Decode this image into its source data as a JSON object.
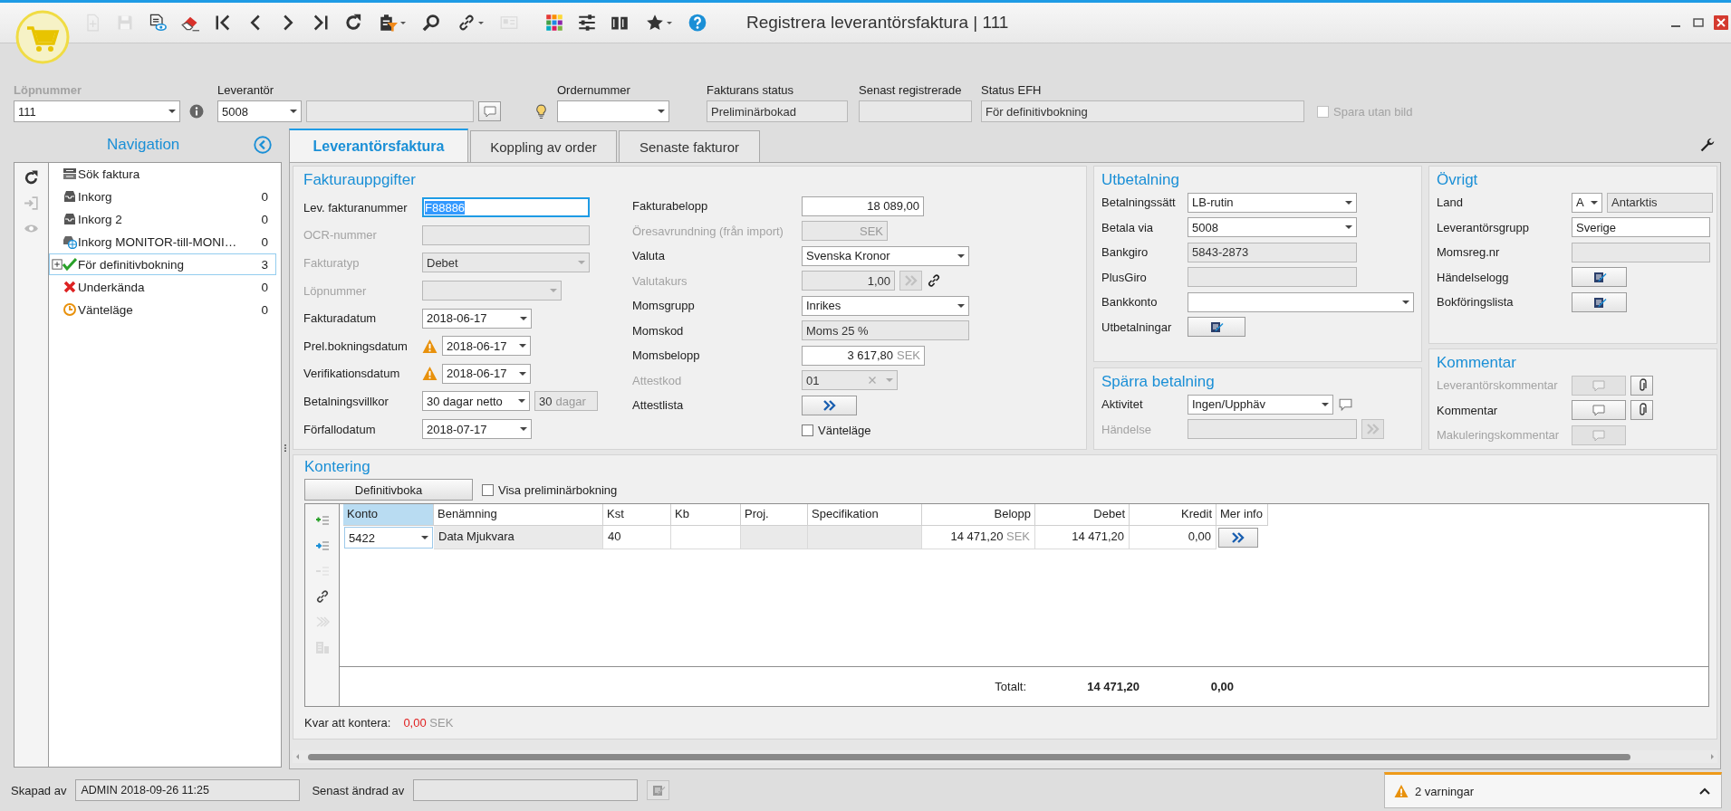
{
  "window": {
    "title": "Registrera leverantörsfaktura | 111"
  },
  "toolbar": [
    {
      "kind": "new",
      "disabled": true
    },
    {
      "kind": "save",
      "disabled": true
    },
    {
      "kind": "preview",
      "disabled": false
    },
    {
      "kind": "erase",
      "disabled": false
    },
    {
      "kind": "first",
      "disabled": false
    },
    {
      "kind": "previous",
      "disabled": false
    },
    {
      "kind": "next",
      "disabled": false
    },
    {
      "kind": "last",
      "disabled": false
    },
    {
      "kind": "refresh",
      "disabled": false
    },
    {
      "kind": "clipboard",
      "disabled": false,
      "dropdown": true
    },
    {
      "kind": "search",
      "disabled": false
    },
    {
      "kind": "link",
      "disabled": false,
      "dropdown": true
    },
    {
      "kind": "card",
      "disabled": true
    },
    {
      "kind": "colors",
      "disabled": false
    },
    {
      "kind": "sliders",
      "disabled": false
    },
    {
      "kind": "book",
      "disabled": false
    },
    {
      "kind": "star",
      "disabled": false,
      "dropdown": true
    },
    {
      "kind": "help",
      "disabled": false
    }
  ],
  "header": [
    {
      "label": "Löpnummer",
      "label_disabled": true,
      "fields": [
        {
          "kind": "combo",
          "value": "111"
        },
        {
          "kind": "info_button",
          "disabled": false
        }
      ]
    },
    {
      "label": "Leverantör",
      "label_disabled": false,
      "fields": [
        {
          "kind": "combo",
          "value": "5008"
        },
        {
          "kind": "text",
          "readonly": true
        },
        {
          "kind": "comment_button",
          "disabled": false
        }
      ]
    },
    {
      "fields": [
        {
          "kind": "bulb_icon"
        }
      ]
    },
    {
      "label": "Ordernummer",
      "label_disabled": false,
      "fields": [
        {
          "kind": "combo"
        }
      ]
    },
    {
      "label": "Fakturans status",
      "label_disabled": false,
      "fields": [
        {
          "kind": "text",
          "readonly": true,
          "value": "Preliminärbokad"
        }
      ]
    },
    {
      "label": "Senast registrerade",
      "label_disabled": false,
      "fields": [
        {
          "kind": "text",
          "readonly": true
        }
      ]
    },
    {
      "label": "Status EFH",
      "label_disabled": false,
      "fields": [
        {
          "kind": "text",
          "readonly": true,
          "value": "För definitivbokning"
        }
      ]
    },
    {
      "fields": [
        {
          "kind": "checkbox",
          "label": "Spara utan bild",
          "checked": false,
          "disabled": true
        }
      ]
    }
  ],
  "navigation": {
    "title": "Navigation",
    "tools": [
      {
        "kind": "refresh",
        "disabled": false
      },
      {
        "kind": "login",
        "disabled": true
      },
      {
        "kind": "eye",
        "disabled": true
      }
    ],
    "items": [
      {
        "kind": "search",
        "label": "Sök faktura",
        "selected": false
      },
      {
        "kind": "inbox",
        "label": "Inkorg",
        "count": "0",
        "selected": false
      },
      {
        "kind": "inbox",
        "label": "Inkorg 2",
        "count": "0",
        "selected": false
      },
      {
        "kind": "inbox_globe",
        "label": "Inkorg MONITOR-till-MONI…",
        "count": "0",
        "selected": false
      },
      {
        "kind": "check",
        "label": "För definitivbokning",
        "count": "3",
        "selected": true,
        "expanded": false
      },
      {
        "kind": "cross",
        "label": "Underkända",
        "count": "0",
        "selected": false
      },
      {
        "kind": "clock",
        "label": "Vänteläge",
        "count": "0",
        "selected": false
      }
    ]
  },
  "tabs": [
    {
      "label": "Leverantörsfaktura",
      "selected": true
    },
    {
      "label": "Koppling av order",
      "selected": false
    },
    {
      "label": "Senaste fakturor",
      "selected": false
    }
  ],
  "fakturauppgifter": {
    "title": "Fakturauppgifter",
    "left": [
      {
        "label": "Lev. fakturanummer",
        "label_disabled": false,
        "fields": [
          {
            "kind": "text",
            "value": "F88886",
            "focused": true
          }
        ]
      },
      {
        "label": "OCR-nummer",
        "label_disabled": true,
        "fields": [
          {
            "kind": "text",
            "readonly": true
          }
        ]
      },
      {
        "label": "Fakturatyp",
        "label_disabled": true,
        "fields": [
          {
            "kind": "combo",
            "readonly": true,
            "value": "Debet"
          }
        ]
      },
      {
        "label": "Löpnummer",
        "label_disabled": true,
        "fields": [
          {
            "kind": "combo",
            "readonly": true
          }
        ]
      },
      {
        "label": "Fakturadatum",
        "label_disabled": false,
        "fields": [
          {
            "kind": "combo",
            "value": "2018-06-17"
          }
        ]
      },
      {
        "label": "Prel.bokningsdatum",
        "label_disabled": false,
        "fields": [
          {
            "kind": "warning_icon"
          },
          {
            "kind": "combo",
            "value": "2018-06-17"
          }
        ]
      },
      {
        "label": "Verifikationsdatum",
        "label_disabled": false,
        "fields": [
          {
            "kind": "warning_icon"
          },
          {
            "kind": "combo",
            "value": "2018-06-17"
          }
        ]
      },
      {
        "label": "Betalningsvillkor",
        "label_disabled": false,
        "fields": [
          {
            "kind": "combo",
            "value": "30 dagar netto"
          },
          {
            "kind": "text",
            "readonly": true,
            "value": "30",
            "suffix": "dagar"
          }
        ]
      },
      {
        "label": "Förfallodatum",
        "label_disabled": false,
        "fields": [
          {
            "kind": "combo",
            "value": "2018-07-17"
          }
        ]
      }
    ],
    "right": [
      {
        "label": "Fakturabelopp",
        "label_disabled": false,
        "fields": [
          {
            "kind": "amount",
            "value": "18 089,00"
          }
        ]
      },
      {
        "label": "Öresavrundning (från import)",
        "label_disabled": true,
        "fields": [
          {
            "kind": "amount",
            "readonly": true,
            "suffix": "SEK"
          }
        ]
      },
      {
        "label": "Valuta",
        "label_disabled": false,
        "fields": [
          {
            "kind": "combo",
            "value": "Svenska Kronor"
          }
        ]
      },
      {
        "label": "Valutakurs",
        "label_disabled": true,
        "fields": [
          {
            "kind": "amount",
            "readonly": true,
            "value": "1,00"
          },
          {
            "kind": "chevron_button",
            "disabled": true
          },
          {
            "kind": "link_icon"
          }
        ]
      },
      {
        "label": "Momsgrupp",
        "label_disabled": false,
        "fields": [
          {
            "kind": "combo",
            "value": "Inrikes"
          }
        ]
      },
      {
        "label": "Momskod",
        "label_disabled": false,
        "fields": [
          {
            "kind": "text",
            "readonly": true,
            "value": "Moms 25 %"
          }
        ]
      },
      {
        "label": "Momsbelopp",
        "label_disabled": false,
        "fields": [
          {
            "kind": "amount",
            "value": "3 617,80",
            "suffix": "SEK"
          }
        ]
      },
      {
        "label": "Attestkod",
        "label_disabled": true,
        "fields": [
          {
            "kind": "combo",
            "readonly": true,
            "value": "01",
            "clearable": true
          }
        ]
      },
      {
        "label": "Attestlista",
        "label_disabled": false,
        "fields": [
          {
            "kind": "chevron_button",
            "disabled": false
          }
        ]
      },
      {
        "fields": [
          {
            "kind": "checkbox",
            "label": "Vänteläge",
            "checked": false,
            "disabled": false
          }
        ]
      }
    ]
  },
  "utbetalning": {
    "title": "Utbetalning",
    "rows": [
      {
        "label": "Betalningssätt",
        "label_disabled": false,
        "fields": [
          {
            "kind": "combo",
            "value": "LB-rutin"
          }
        ]
      },
      {
        "label": "Betala via",
        "label_disabled": false,
        "fields": [
          {
            "kind": "combo",
            "value": "5008"
          }
        ]
      },
      {
        "label": "Bankgiro",
        "label_disabled": false,
        "fields": [
          {
            "kind": "text",
            "readonly": true,
            "value": "5843-2873"
          }
        ]
      },
      {
        "label": "PlusGiro",
        "label_disabled": false,
        "fields": [
          {
            "kind": "text",
            "readonly": true
          }
        ]
      },
      {
        "label": "Bankkonto",
        "label_disabled": false,
        "fields": [
          {
            "kind": "combo"
          }
        ]
      },
      {
        "label": "Utbetalningar",
        "label_disabled": false,
        "fields": [
          {
            "kind": "edit_button",
            "disabled": false
          }
        ]
      }
    ]
  },
  "sparra_betalning": {
    "title": "Spärra betalning",
    "rows": [
      {
        "label": "Aktivitet",
        "label_disabled": false,
        "fields": [
          {
            "kind": "combo",
            "value": "Ingen/Upphäv"
          },
          {
            "kind": "comment_icon"
          }
        ]
      },
      {
        "label": "Händelse",
        "label_disabled": true,
        "fields": [
          {
            "kind": "text",
            "readonly": true
          },
          {
            "kind": "chevron_button",
            "disabled": true
          }
        ]
      }
    ]
  },
  "ovrigt": {
    "title": "Övrigt",
    "rows": [
      {
        "label": "Land",
        "label_disabled": false,
        "fields": [
          {
            "kind": "combo",
            "value": "A"
          },
          {
            "kind": "text",
            "readonly": true,
            "value": "Antarktis"
          }
        ]
      },
      {
        "label": "Leverantörsgrupp",
        "label_disabled": false,
        "fields": [
          {
            "kind": "text",
            "value": "Sverige"
          }
        ]
      },
      {
        "label": "Momsreg.nr",
        "label_disabled": false,
        "fields": [
          {
            "kind": "text",
            "readonly": true
          }
        ]
      },
      {
        "label": "Händelselogg",
        "label_disabled": false,
        "fields": [
          {
            "kind": "edit_button",
            "disabled": false
          }
        ]
      },
      {
        "label": "Bokföringslista",
        "label_disabled": false,
        "fields": [
          {
            "kind": "edit_button",
            "disabled": false
          }
        ]
      }
    ]
  },
  "kommentar": {
    "title": "Kommentar",
    "rows": [
      {
        "label": "Leverantörskommentar",
        "label_disabled": true,
        "fields": [
          {
            "kind": "comment_button",
            "disabled": true
          },
          {
            "kind": "attach_button",
            "disabled": false
          }
        ]
      },
      {
        "label": "Kommentar",
        "label_disabled": false,
        "fields": [
          {
            "kind": "comment_button",
            "disabled": false
          },
          {
            "kind": "attach_button",
            "disabled": false
          }
        ]
      },
      {
        "label": "Makuleringskommentar",
        "label_disabled": true,
        "fields": [
          {
            "kind": "comment_button",
            "disabled": true
          }
        ]
      }
    ]
  },
  "kontering": {
    "title": "Kontering",
    "button": "Definitivboka",
    "checkbox": {
      "label": "Visa preliminärbokning",
      "checked": false
    },
    "tools": [
      {
        "kind": "add_row",
        "disabled": false
      },
      {
        "kind": "insert_row",
        "disabled": false
      },
      {
        "kind": "remove_row",
        "disabled": true
      },
      {
        "kind": "link",
        "disabled": false
      },
      {
        "kind": "distribute",
        "disabled": true
      },
      {
        "kind": "building",
        "disabled": true
      }
    ],
    "columns": [
      {
        "label": "Konto",
        "selected": true
      },
      {
        "label": "Benämning",
        "selected": false
      },
      {
        "label": "Kst",
        "selected": false
      },
      {
        "label": "Kb",
        "selected": false
      },
      {
        "label": "Proj.",
        "selected": false
      },
      {
        "label": "Specifikation",
        "selected": false
      },
      {
        "label": "Belopp",
        "selected": false
      },
      {
        "label": "Debet",
        "selected": false
      },
      {
        "label": "Kredit",
        "selected": false
      },
      {
        "label": "Mer info",
        "selected": false
      }
    ],
    "rows": [
      {
        "konto": "5422",
        "benamning": "Data Mjukvara",
        "kst": "40",
        "belopp": "14 471,20",
        "currency": "SEK",
        "debet": "14 471,20",
        "kredit": "0,00"
      }
    ],
    "totals": {
      "label": "Totalt:",
      "debet": "14 471,20",
      "kredit": "0,00"
    },
    "remaining": {
      "label": "Kvar att kontera:",
      "value": "0,00",
      "currency": "SEK"
    }
  },
  "status_bar": {
    "created_label": "Skapad av",
    "created": "ADMIN 2018-09-26 11:25",
    "changed_label": "Senast ändrad av",
    "warnings": "2 varningar"
  }
}
